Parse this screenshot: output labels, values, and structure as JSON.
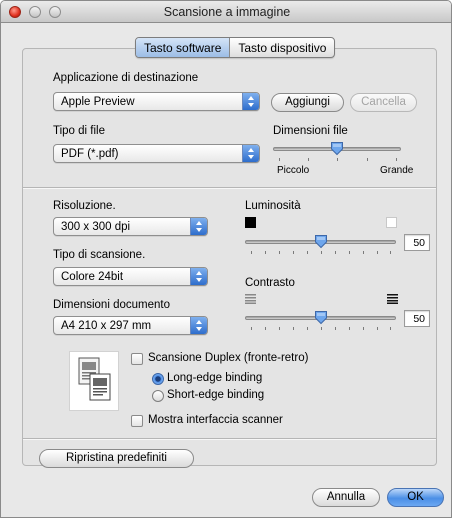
{
  "window": {
    "title": "Scansione a immagine"
  },
  "tabs": [
    {
      "label": "Tasto software",
      "active": true
    },
    {
      "label": "Tasto dispositivo",
      "active": false
    }
  ],
  "destination": {
    "label": "Applicazione di destinazione",
    "value": "Apple Preview",
    "add_label": "Aggiungi",
    "delete_label": "Cancella"
  },
  "file_type": {
    "label": "Tipo di file",
    "value": "PDF (*.pdf)"
  },
  "file_size": {
    "label": "Dimensioni file",
    "min_label": "Piccolo",
    "max_label": "Grande",
    "level": 0.5
  },
  "resolution": {
    "label": "Risoluzione.",
    "value": "300 x 300 dpi"
  },
  "scan_type": {
    "label": "Tipo di scansione.",
    "value": "Colore 24bit"
  },
  "doc_size": {
    "label": "Dimensioni documento",
    "value": "A4  210 x 297 mm"
  },
  "brightness": {
    "label": "Luminosità",
    "value": "50",
    "level": 0.5
  },
  "contrast": {
    "label": "Contrasto",
    "value": "50",
    "level": 0.5
  },
  "duplex": {
    "checkbox_label": "Scansione Duplex (fronte-retro)",
    "checked": false,
    "options": [
      {
        "label": "Long-edge binding",
        "selected": true
      },
      {
        "label": "Short-edge binding",
        "selected": false
      }
    ]
  },
  "show_scanner": {
    "label": "Mostra interfaccia scanner",
    "checked": false
  },
  "buttons": {
    "restore_defaults": "Ripristina predefiniti",
    "cancel": "Annulla",
    "ok": "OK"
  },
  "colors": {
    "accent": "#3b7fdf",
    "panel_bg": "#e4e4e4",
    "window_bg": "#e8e8e8"
  },
  "icons": {
    "brightness_low": "black-square-icon",
    "brightness_high": "white-square-icon",
    "contrast_low": "low-contrast-lines-icon",
    "contrast_high": "high-contrast-lines-icon",
    "duplex_preview": "duplex-pages-icon"
  }
}
